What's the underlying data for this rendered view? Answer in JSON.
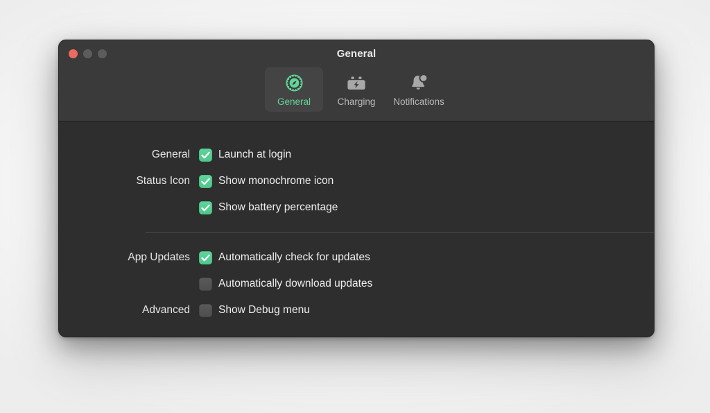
{
  "window": {
    "title": "General",
    "traffic_lights": [
      {
        "name": "close",
        "color": "#ec6a5f"
      },
      {
        "name": "minimize",
        "color": "#5c5c5c"
      },
      {
        "name": "zoom",
        "color": "#5c5c5c"
      }
    ]
  },
  "toolbar": {
    "tabs": [
      {
        "label": "General",
        "icon": "gear-circle-icon",
        "selected": true
      },
      {
        "label": "Charging",
        "icon": "battery-bolt-icon",
        "selected": false
      },
      {
        "label": "Notifications",
        "icon": "bell-badge-icon",
        "selected": false
      }
    ]
  },
  "colors": {
    "accent_green": "#4ec88c",
    "selected_tab_text": "#63d59a",
    "window_background": "#2e2e2e",
    "toolbar_background": "#3a3a3a",
    "text_primary": "#eeeeee",
    "divider": "#4b4b4b"
  },
  "sections": [
    {
      "rows": [
        {
          "label": "General",
          "checkbox": {
            "label": "Launch at login",
            "checked": true
          }
        },
        {
          "label": "Status Icon",
          "checkbox": {
            "label": "Show monochrome icon",
            "checked": true
          }
        },
        {
          "label": "",
          "checkbox": {
            "label": "Show battery percentage",
            "checked": true
          }
        }
      ]
    },
    {
      "rows": [
        {
          "label": "App Updates",
          "checkbox": {
            "label": "Automatically check for updates",
            "checked": true
          }
        },
        {
          "label": "",
          "checkbox": {
            "label": "Automatically download updates",
            "checked": false
          }
        },
        {
          "label": "Advanced",
          "checkbox": {
            "label": "Show Debug menu",
            "checked": false
          }
        }
      ]
    }
  ]
}
